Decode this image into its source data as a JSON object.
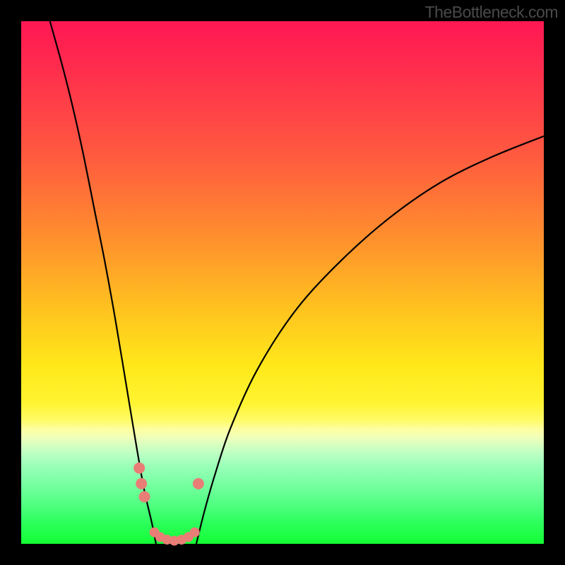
{
  "watermark": "TheBottleneck.com",
  "chart_data": {
    "type": "line",
    "title": "",
    "xlabel": "",
    "ylabel": "",
    "xlim": [
      0,
      1
    ],
    "ylim": [
      0,
      1
    ],
    "series": [
      {
        "name": "left-curve",
        "x": [
          0.055,
          0.08,
          0.1,
          0.12,
          0.14,
          0.16,
          0.18,
          0.2,
          0.22,
          0.235,
          0.25,
          0.258
        ],
        "y": [
          1.0,
          0.91,
          0.83,
          0.74,
          0.64,
          0.54,
          0.43,
          0.31,
          0.19,
          0.105,
          0.04,
          0.0
        ]
      },
      {
        "name": "right-curve",
        "x": [
          0.335,
          0.35,
          0.37,
          0.4,
          0.45,
          0.52,
          0.6,
          0.7,
          0.8,
          0.9,
          1.0
        ],
        "y": [
          0.0,
          0.06,
          0.13,
          0.22,
          0.33,
          0.44,
          0.53,
          0.62,
          0.69,
          0.74,
          0.78
        ]
      }
    ],
    "annotations": {
      "highlight_dots_left": {
        "x": [
          0.226,
          0.23,
          0.236
        ],
        "y": [
          0.145,
          0.115,
          0.09
        ]
      },
      "highlight_dots_right": {
        "x": [
          0.339
        ],
        "y": [
          0.115
        ]
      },
      "highlight_bottom_chain": {
        "x": [
          0.255,
          0.266,
          0.279,
          0.293,
          0.307,
          0.32,
          0.332
        ],
        "y": [
          0.022,
          0.013,
          0.008,
          0.006,
          0.008,
          0.013,
          0.022
        ]
      }
    },
    "colors": {
      "curve": "#000000",
      "dots": "#e87e76",
      "gradient_top": "#ff1753",
      "gradient_mid": "#ffe81a",
      "gradient_bottom": "#13ff34"
    }
  }
}
